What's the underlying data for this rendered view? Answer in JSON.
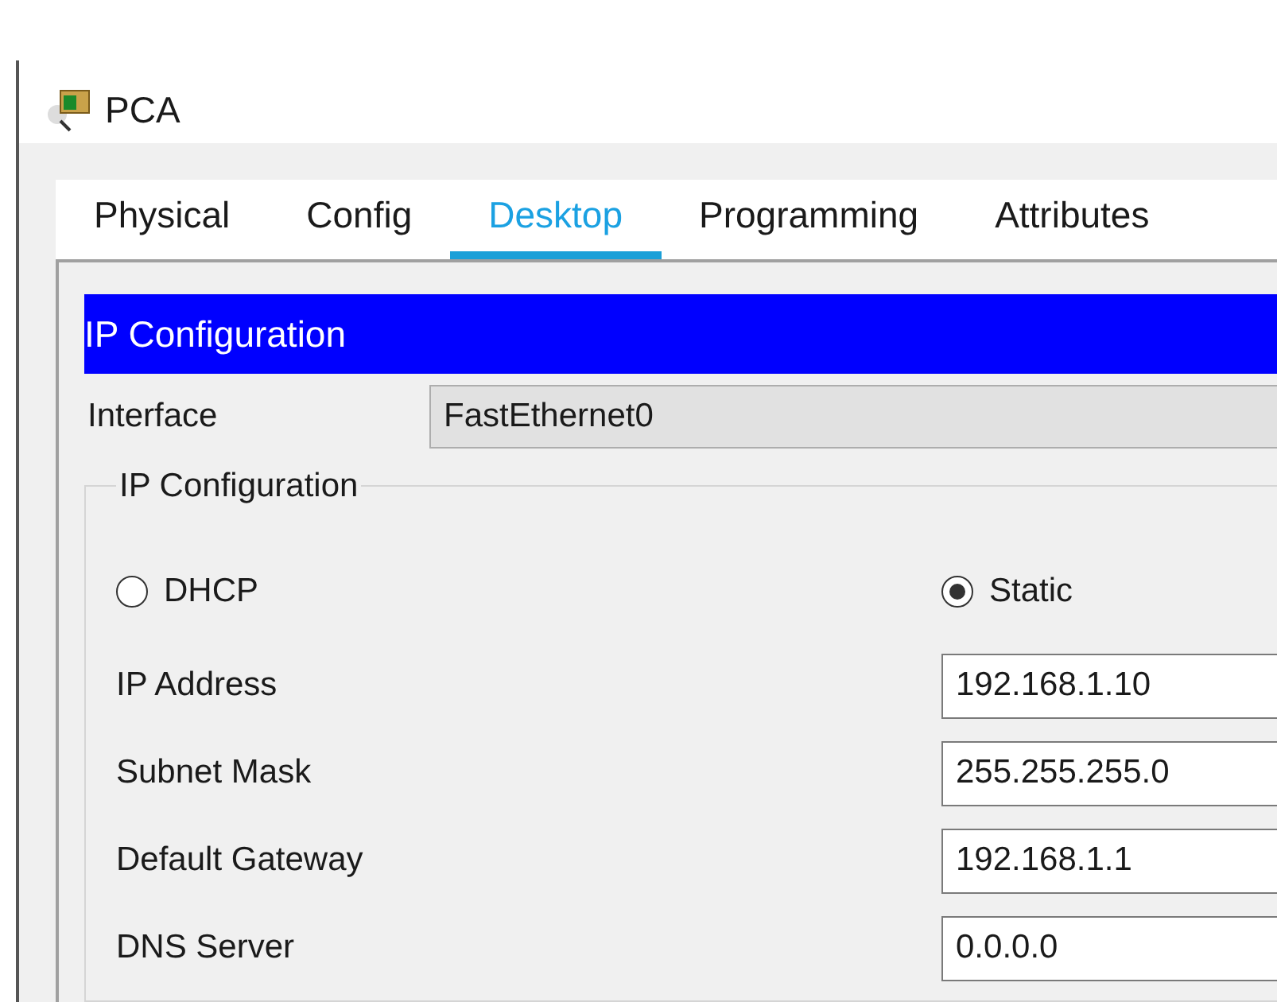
{
  "window": {
    "title": "PCA"
  },
  "tabs": [
    {
      "label": "Physical",
      "selected": false
    },
    {
      "label": "Config",
      "selected": false
    },
    {
      "label": "Desktop",
      "selected": true
    },
    {
      "label": "Programming",
      "selected": false
    },
    {
      "label": "Attributes",
      "selected": false
    }
  ],
  "header": "IP Configuration",
  "interface": {
    "label": "Interface",
    "value": "FastEthernet0"
  },
  "group": {
    "title": "IP Configuration",
    "modes": [
      {
        "label": "DHCP",
        "selected": false
      },
      {
        "label": "Static",
        "selected": true
      }
    ],
    "fields": [
      {
        "label": "IP Address",
        "value": "192.168.1.10"
      },
      {
        "label": "Subnet Mask",
        "value": "255.255.255.0"
      },
      {
        "label": "Default Gateway",
        "value": "192.168.1.1"
      },
      {
        "label": "DNS Server",
        "value": "0.0.0.0"
      }
    ]
  }
}
